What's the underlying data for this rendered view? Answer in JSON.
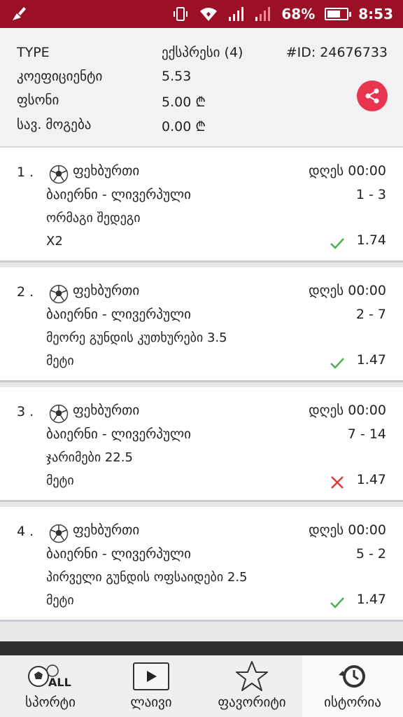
{
  "statusbar": {
    "battery_percent": "68%",
    "battery_level": 0.68,
    "time": "8:53",
    "icons": [
      "cleaner-icon",
      "vibrate-icon",
      "wifi-icon",
      "signal-icon",
      "signal-weak-icon",
      "battery-icon"
    ]
  },
  "ticket": {
    "type_label": "TYPE",
    "type_value": "ექსპრესი (4)",
    "id_label": "#ID: 24676733",
    "coef_label": "კოეფიციენტი",
    "coef_value": "5.53",
    "stake_label": "ფსონი",
    "stake_value": "5.00 ₾",
    "win_label": "სავ. მოგება",
    "win_value": "0.00 ₾"
  },
  "bets": [
    {
      "num": "1 .",
      "sport": "ფეხბურთი",
      "time": "დღეს 00:00",
      "match": "ბაიერნი - ლივერპული",
      "score": "1 - 3",
      "market": "ორმაგი შედეგი",
      "pick": "X2",
      "status": "won",
      "odd": "1.74"
    },
    {
      "num": "2 .",
      "sport": "ფეხბურთი",
      "time": "დღეს 00:00",
      "match": "ბაიერნი - ლივერპული",
      "score": "2 - 7",
      "market": "მეორე გუნდის კუთხურები 3.5",
      "pick": "მეტი",
      "status": "won",
      "odd": "1.47"
    },
    {
      "num": "3 .",
      "sport": "ფეხბურთი",
      "time": "დღეს 00:00",
      "match": "ბაიერნი - ლივერპული",
      "score": "7 - 14",
      "market": "ჯარიმები 22.5",
      "pick": "მეტი",
      "status": "lost",
      "odd": "1.47"
    },
    {
      "num": "4 .",
      "sport": "ფეხბურთი",
      "time": "დღეს 00:00",
      "match": "ბაიერნი - ლივერპული",
      "score": "5 - 2",
      "market": "პირველი გუნდის ოფსაიდები 2.5",
      "pick": "მეტი",
      "status": "won",
      "odd": "1.47"
    }
  ],
  "nav": {
    "sports_label": "სპორტი",
    "sports_badge": "ALL",
    "live_label": "ლაივი",
    "fav_label": "ფავორიტი",
    "history_label": "ისტორია"
  },
  "colors": {
    "statusbar": "#9c1027",
    "share": "#e8344e",
    "won": "#4caf50",
    "lost": "#e53935"
  }
}
